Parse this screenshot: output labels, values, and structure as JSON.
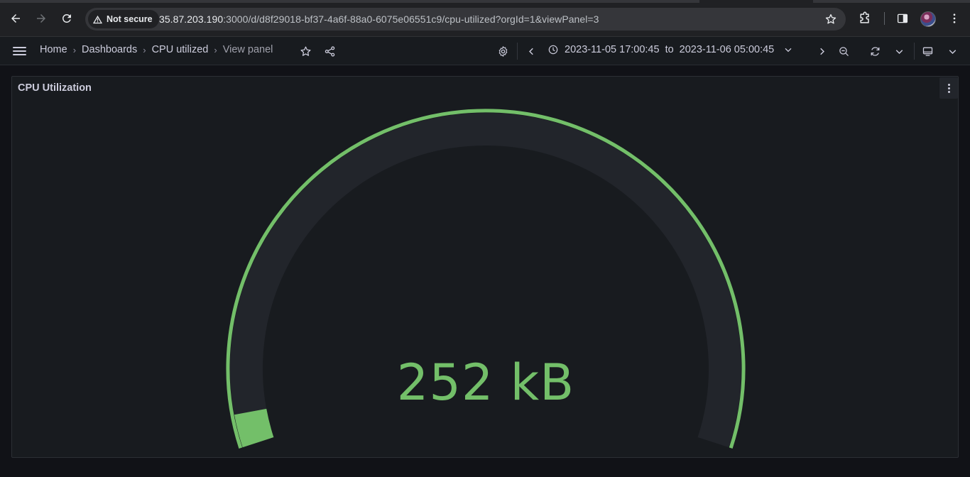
{
  "browser": {
    "security_label": "Not secure",
    "url_host": "35.87.203.190",
    "url_rest": ":3000/d/d8f29018-bf37-4a6f-88a0-6075e06551c9/cpu-utilized?orgId=1&viewPanel=3"
  },
  "breadcrumb": {
    "home": "Home",
    "dashboards": "Dashboards",
    "dashboard": "CPU utilized",
    "current": "View panel"
  },
  "time_range": {
    "from": "2023-11-05 17:00:45",
    "separator": "to",
    "to": "2023-11-06 05:00:45"
  },
  "panel": {
    "title": "CPU Utilization",
    "value_display": "252 kB",
    "fill_fraction": 0.035,
    "colors": {
      "value": "#73bf69",
      "threshold": "#73bf69",
      "track": "#22252b"
    }
  },
  "icons": {
    "back": "arrow-left-icon",
    "forward": "arrow-right-icon",
    "reload": "reload-icon",
    "warning": "warning-icon",
    "bookmark": "star-icon",
    "extensions": "puzzle-icon",
    "side_panel": "side-panel-icon",
    "menu": "kebab-icon",
    "settings": "gear-icon",
    "clock": "clock-icon",
    "zoom_out": "zoom-out-icon",
    "refresh": "refresh-icon",
    "tv": "tv-mode-icon",
    "share": "share-icon"
  }
}
